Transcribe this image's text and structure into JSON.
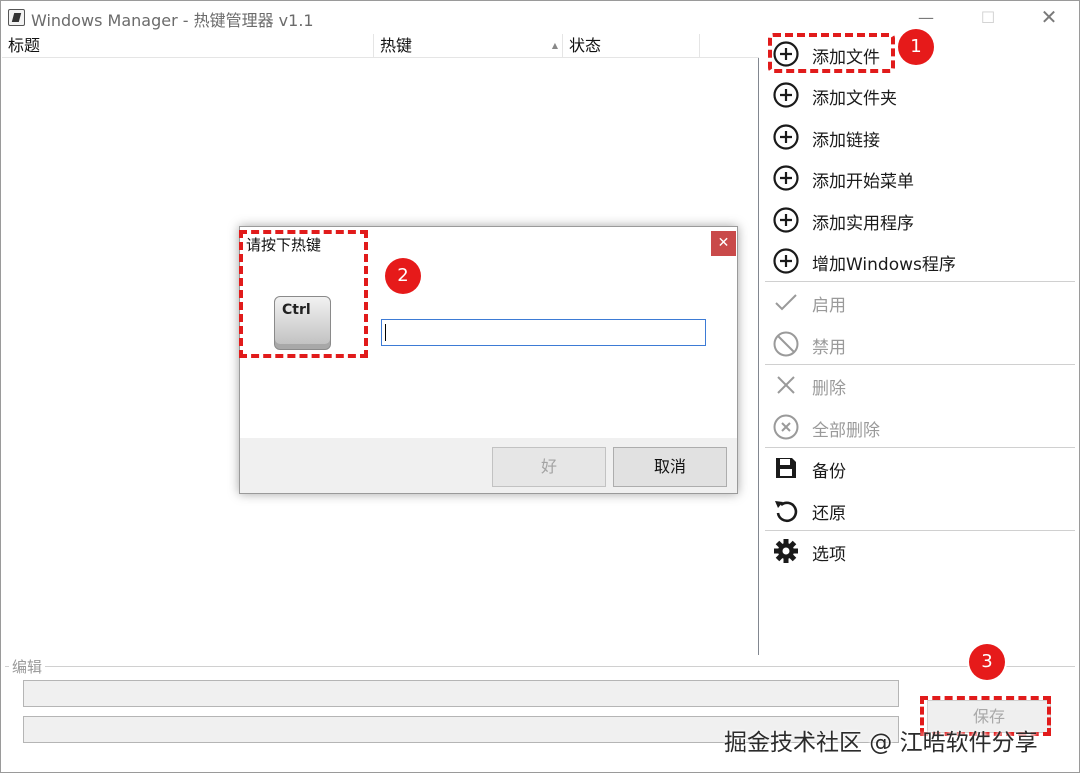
{
  "window": {
    "title": "Windows Manager - 热键管理器 v1.1",
    "minimize_glyph": "—",
    "maximize_glyph": "☐",
    "close_glyph": "✕"
  },
  "list": {
    "columns": [
      "标题",
      "热键",
      "状态"
    ],
    "sort_glyph": "▲",
    "rows": []
  },
  "menu": {
    "items": [
      {
        "label": "添加文件",
        "icon": "add-circle-icon",
        "enabled": true
      },
      {
        "label": "添加文件夹",
        "icon": "add-circle-icon",
        "enabled": true
      },
      {
        "label": "添加链接",
        "icon": "add-circle-icon",
        "enabled": true
      },
      {
        "label": "添加开始菜单",
        "icon": "add-circle-icon",
        "enabled": true
      },
      {
        "label": "添加实用程序",
        "icon": "add-circle-icon",
        "enabled": true
      },
      {
        "label": "增加Windows程序",
        "icon": "add-circle-icon",
        "enabled": true
      },
      {
        "label": "启用",
        "icon": "check-icon",
        "enabled": false
      },
      {
        "label": "禁用",
        "icon": "ban-icon",
        "enabled": false
      },
      {
        "label": "删除",
        "icon": "x-icon",
        "enabled": false
      },
      {
        "label": "全部删除",
        "icon": "x-circle-icon",
        "enabled": false
      },
      {
        "label": "备份",
        "icon": "floppy-icon",
        "enabled": true
      },
      {
        "label": "还原",
        "icon": "undo-icon",
        "enabled": true
      },
      {
        "label": "选项",
        "icon": "gear-icon",
        "enabled": true
      }
    ]
  },
  "edit": {
    "group_title": "编辑",
    "field1_value": "",
    "field2_value": "",
    "save_label": "保存"
  },
  "dialog": {
    "title": "请按下热键",
    "close_glyph": "✕",
    "key_label": "Ctrl",
    "input_value": "",
    "ok_label": "好",
    "cancel_label": "取消"
  },
  "annotations": {
    "badge1": "1",
    "badge2": "2",
    "badge3": "3",
    "color": "#e11b1b"
  },
  "watermark": "掘金技术社区 @ 江晧软件分享"
}
